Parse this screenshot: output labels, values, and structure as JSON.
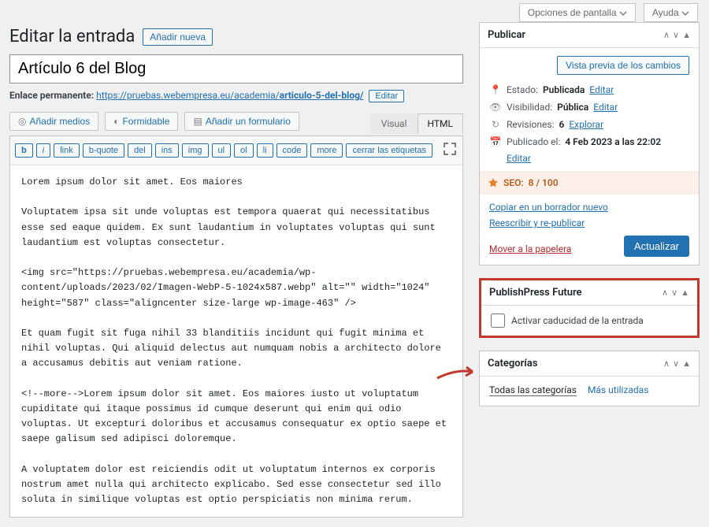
{
  "topbar": {
    "screen_options": "Opciones de pantalla",
    "help": "Ayuda"
  },
  "header": {
    "title": "Editar la entrada",
    "add_new": "Añadir nueva"
  },
  "post": {
    "title": "Artículo 6 del Blog",
    "permalink_label": "Enlace permanente:",
    "permalink_base": "https://pruebas.webempresa.eu/academia/",
    "permalink_slug": "articulo-5-del-blog/",
    "edit_label": "Editar"
  },
  "media": {
    "add_media": "Añadir medios",
    "formidable": "Formidable",
    "add_form": "Añadir un formulario"
  },
  "tabs": {
    "visual": "Visual",
    "html": "HTML"
  },
  "toolbar": [
    "b",
    "i",
    "link",
    "b-quote",
    "del",
    "ins",
    "img",
    "ul",
    "ol",
    "li",
    "code",
    "more",
    "cerrar las etiquetas"
  ],
  "editor_content": "Lorem ipsum dolor sit amet. Eos maiores\n\nVoluptatem ipsa sit unde voluptas est tempora quaerat qui necessitatibus esse sed eaque quidem. Ex sunt laudantium in voluptates voluptas qui sunt laudantium est voluptas consectetur.\n\n<img src=\"https://pruebas.webempresa.eu/academia/wp-content/uploads/2023/02/Imagen-WebP-5-1024x587.webp\" alt=\"\" width=\"1024\" height=\"587\" class=\"aligncenter size-large wp-image-463\" />\n\nEt quam fugit sit fuga nihil 33 blanditiis incidunt qui fugit minima et nihil voluptas. Qui aliquid delectus aut numquam nobis a architecto dolore a accusamus debitis aut veniam ratione.\n\n<!--more-->Lorem ipsum dolor sit amet. Eos maiores iusto ut voluptatum cupiditate qui itaque possimus id cumque deserunt qui enim qui odio voluptas. Ut excepturi doloribus et accusamus consequatur ex optio saepe et saepe galisum sed adipisci doloremque.\n\nA voluptatem dolor est reiciendis odit ut voluptatum internos ex corporis nostrum amet nulla qui architecto explicabo. Sed esse consectetur sed illo soluta in similique voluptas est optio perspiciatis non minima rerum.",
  "publish": {
    "panel_title": "Publicar",
    "preview": "Vista previa de los cambios",
    "status_label": "Estado:",
    "status_value": "Publicada",
    "visibility_label": "Visibilidad:",
    "visibility_value": "Pública",
    "revisions_label": "Revisiones:",
    "revisions_value": "6",
    "revisions_browse": "Explorar",
    "published_label": "Publicado el:",
    "published_value": "4 Feb 2023 a las 22:02",
    "edit": "Editar",
    "seo_label": "SEO:",
    "seo_score": "8 / 100",
    "copy_draft": "Copiar en un borrador nuevo",
    "rewrite": "Reescribir y re-publicar",
    "trash": "Mover a la papelera",
    "update": "Actualizar"
  },
  "future": {
    "panel_title": "PublishPress Future",
    "checkbox_label": "Activar caducidad de la entrada"
  },
  "categories": {
    "panel_title": "Categorías",
    "tab_all": "Todas las categorías",
    "tab_most": "Más utilizadas"
  }
}
